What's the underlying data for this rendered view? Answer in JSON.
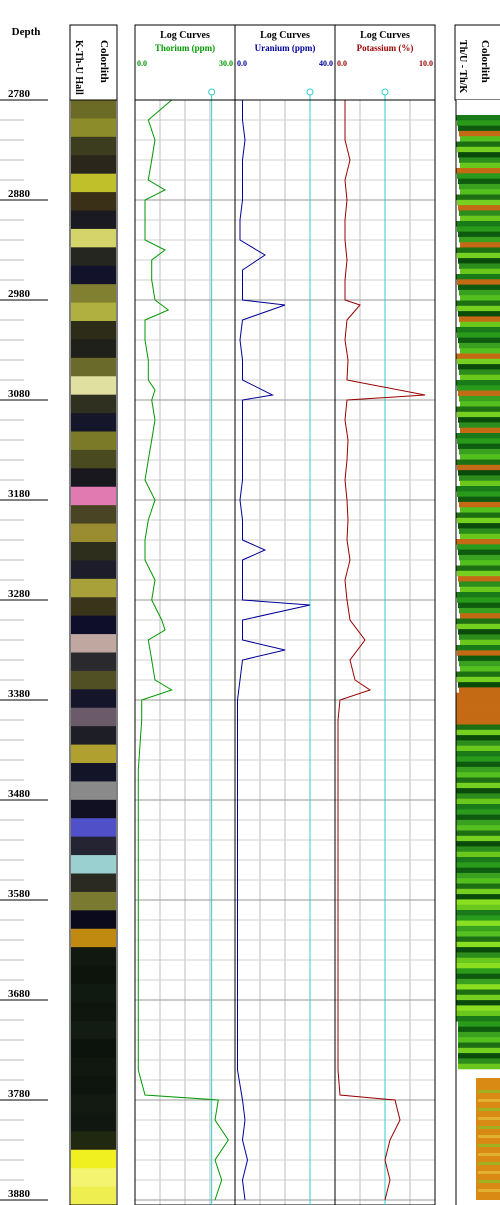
{
  "depth_header": "Depth",
  "colorlith_left": {
    "title": "Colorlith",
    "subtitle": "K-Th-U Hall",
    "colors": [
      "#6b6b26",
      "#8c8c2a",
      "#3c3c1e",
      "#2a261c",
      "#c0c02a",
      "#3a3018",
      "#1a1a22",
      "#d4d46a",
      "#262620",
      "#12122a",
      "#808030",
      "#b0b040",
      "#2c2c18",
      "#20201a",
      "#6a6a2a",
      "#e0e0a0",
      "#303020",
      "#16162a",
      "#7a7a28",
      "#4a4a20",
      "#18181e",
      "#e07ab0",
      "#484424",
      "#9a8c30",
      "#2e2e1c",
      "#1c1c2a",
      "#a8a038",
      "#3a341a",
      "#0e0e2a",
      "#c0a8a0",
      "#2a2a2e",
      "#505024",
      "#14142a",
      "#6a5a6a",
      "#1e1e26",
      "#b0a030",
      "#141428",
      "#8a8a8a",
      "#101022",
      "#5050c8",
      "#242432",
      "#9ad0d0",
      "#2a2a22",
      "#7a7a30",
      "#0a0a1c",
      "#c08a10",
      "#101810",
      "#0c140c",
      "#101a10",
      "#0e160e",
      "#121c12",
      "#0c120c",
      "#101810",
      "#0e140e",
      "#121a12",
      "#101610",
      "#202810",
      "#f0f020",
      "#f4f470",
      "#eeee50"
    ]
  },
  "tracks": [
    {
      "header": "Log Curves",
      "name": "Thorium (ppm)",
      "min": "0.0",
      "max": "30.0",
      "color": "#009900"
    },
    {
      "header": "Log Curves",
      "name": "Uranium (ppm)",
      "min": "0.0",
      "max": "40.0",
      "color": "#000099"
    },
    {
      "header": "Log Curves",
      "name": "Potassium (%)",
      "min": "0.0",
      "max": "10.0",
      "color": "#990000"
    }
  ],
  "colorlith_right": {
    "title": "Colorlith",
    "subtitle": "Th/U - Th/K"
  },
  "chart_data": {
    "type": "line",
    "orientation": "vertical-depth",
    "depth_range": [
      2780,
      3880
    ],
    "depth_ticks": [
      2780,
      2880,
      2980,
      3080,
      3180,
      3280,
      3380,
      3480,
      3580,
      3680,
      3780,
      3880
    ],
    "cutoffs": {
      "thorium": 23,
      "uranium": 30,
      "potassium": 5
    },
    "series": [
      {
        "name": "Thorium (ppm)",
        "xlim": [
          0,
          30
        ],
        "depth": [
          2780,
          2800,
          2820,
          2840,
          2860,
          2870,
          2880,
          2900,
          2920,
          2930,
          2940,
          2960,
          2980,
          2990,
          3000,
          3020,
          3040,
          3060,
          3070,
          3080,
          3100,
          3120,
          3140,
          3160,
          3180,
          3200,
          3220,
          3240,
          3260,
          3280,
          3300,
          3310,
          3320,
          3340,
          3360,
          3370,
          3380,
          3400,
          3450,
          3500,
          3550,
          3600,
          3650,
          3700,
          3750,
          3775,
          3780,
          3800,
          3820,
          3840,
          3860,
          3880
        ],
        "values": [
          11,
          4,
          6,
          5,
          4,
          9,
          3,
          3,
          3,
          9,
          5,
          5,
          6,
          10,
          3,
          3,
          4,
          4,
          6,
          5,
          6,
          5,
          4,
          3,
          6,
          4,
          3,
          3,
          6,
          5,
          8,
          9,
          4,
          5,
          6,
          11,
          2,
          2,
          1,
          1,
          1,
          1,
          1,
          1,
          1,
          3,
          25,
          24,
          28,
          24,
          26,
          24
        ]
      },
      {
        "name": "Uranium (ppm)",
        "xlim": [
          0,
          40
        ],
        "depth": [
          2780,
          2800,
          2820,
          2840,
          2860,
          2880,
          2900,
          2920,
          2935,
          2950,
          2980,
          2985,
          3000,
          3020,
          3040,
          3060,
          3075,
          3080,
          3100,
          3120,
          3140,
          3160,
          3180,
          3200,
          3220,
          3230,
          3240,
          3260,
          3280,
          3285,
          3300,
          3320,
          3330,
          3340,
          3360,
          3380,
          3400,
          3450,
          3500,
          3550,
          3600,
          3650,
          3700,
          3750,
          3780,
          3800,
          3820,
          3840,
          3860,
          3880
        ],
        "values": [
          3,
          3,
          4,
          3,
          3,
          3,
          2,
          2,
          12,
          3,
          3,
          20,
          3,
          2,
          3,
          3,
          15,
          3,
          3,
          3,
          3,
          3,
          2,
          3,
          3,
          12,
          3,
          3,
          3,
          30,
          3,
          3,
          20,
          3,
          2,
          1,
          1,
          1,
          1,
          1,
          1,
          1,
          1,
          1,
          3,
          4,
          3,
          5,
          3,
          4
        ]
      },
      {
        "name": "Potassium (%)",
        "xlim": [
          0,
          10
        ],
        "depth": [
          2780,
          2800,
          2820,
          2840,
          2860,
          2880,
          2900,
          2920,
          2940,
          2960,
          2980,
          2985,
          3000,
          3020,
          3040,
          3060,
          3075,
          3080,
          3100,
          3120,
          3140,
          3160,
          3180,
          3200,
          3220,
          3240,
          3260,
          3280,
          3300,
          3320,
          3340,
          3360,
          3370,
          3380,
          3400,
          3450,
          3500,
          3550,
          3600,
          3650,
          3700,
          3750,
          3775,
          3780,
          3800,
          3820,
          3840,
          3860,
          3880
        ],
        "values": [
          1,
          1,
          1,
          1.5,
          1,
          1.2,
          1,
          1,
          1.2,
          1,
          1,
          2.5,
          1.2,
          1,
          1.3,
          1.2,
          9,
          1.2,
          1,
          1.3,
          1.2,
          1,
          1.2,
          1.3,
          1.2,
          1.5,
          1,
          1.2,
          1.5,
          3,
          1.5,
          2,
          3.5,
          0.5,
          0.3,
          0.3,
          0.3,
          0.3,
          0.3,
          0.3,
          0.3,
          0.3,
          0.5,
          6,
          6.5,
          5.5,
          5,
          5.5,
          5
        ]
      }
    ]
  }
}
